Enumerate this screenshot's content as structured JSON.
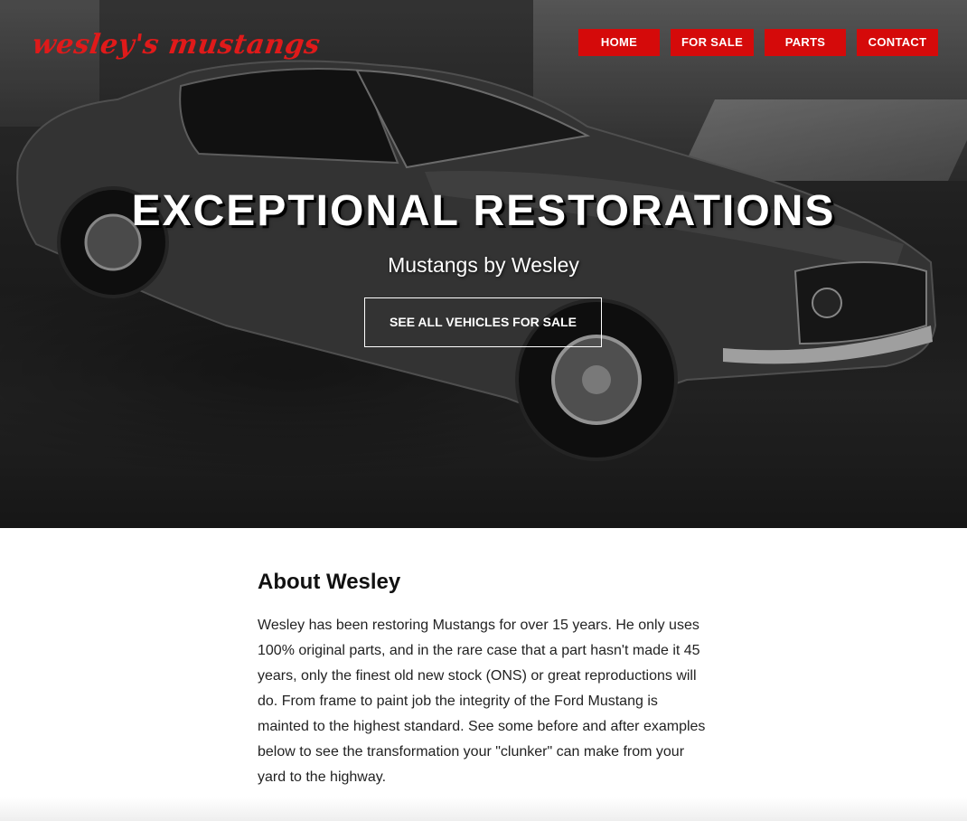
{
  "site": {
    "logo_text": "wesley's mustangs"
  },
  "nav": {
    "items": [
      {
        "label": "HOME"
      },
      {
        "label": "FOR SALE"
      },
      {
        "label": "PARTS"
      },
      {
        "label": "CONTACT"
      }
    ]
  },
  "hero": {
    "title": "EXCEPTIONAL RESTORATIONS",
    "subtitle": "Mustangs by Wesley",
    "cta_label": "SEE ALL VEHICLES FOR SALE",
    "image_description_icon": "car-photo"
  },
  "about": {
    "heading": "About Wesley",
    "body": "Wesley has been restoring Mustangs for over 15 years. He only uses 100% original parts, and in the rare case that a part hasn't made it 45 years, only the finest old new stock (ONS) or great reproductions will do. From frame to paint job the integrity of the Ford Mustang is mainted to the highest standard. See some before and after examples below to see the transformation your \"clunker\" can make from your yard to the highway."
  },
  "colors": {
    "brand_red": "#d50a0a",
    "logo_red": "#e01a1a",
    "text_dark": "#111111"
  }
}
